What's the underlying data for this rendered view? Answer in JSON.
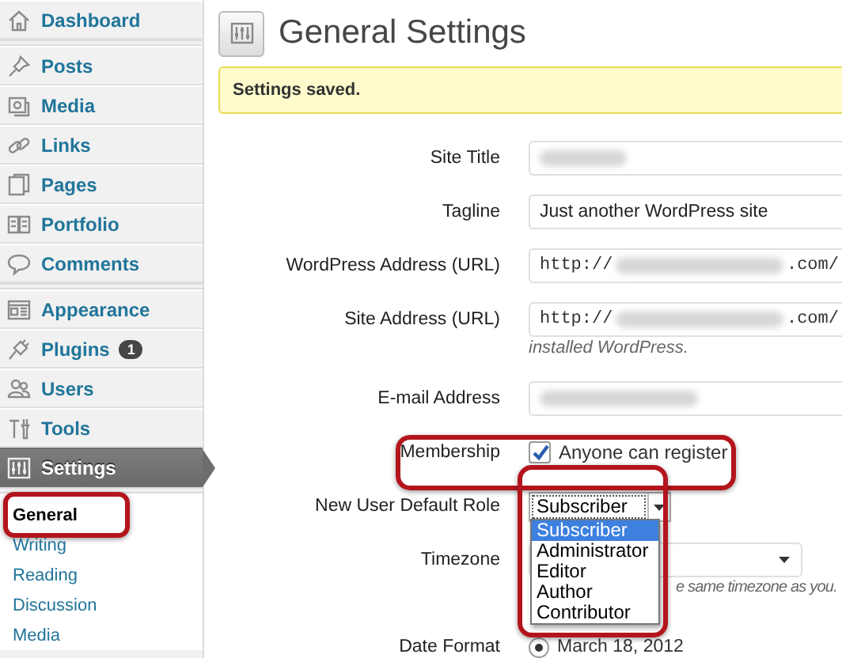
{
  "sidebar": {
    "groups": [
      {
        "items": [
          {
            "label": "Dashboard",
            "kind": "home",
            "selected": false
          }
        ]
      },
      {
        "items": [
          {
            "label": "Posts",
            "kind": "pin",
            "selected": false
          },
          {
            "label": "Media",
            "kind": "media",
            "selected": false
          },
          {
            "label": "Links",
            "kind": "link",
            "selected": false
          },
          {
            "label": "Pages",
            "kind": "pages",
            "selected": false
          },
          {
            "label": "Portfolio",
            "kind": "portfolio",
            "selected": false
          },
          {
            "label": "Comments",
            "kind": "comments",
            "selected": false
          }
        ]
      },
      {
        "items": [
          {
            "label": "Appearance",
            "kind": "appearance",
            "selected": false
          },
          {
            "label": "Plugins",
            "kind": "plugins",
            "selected": false,
            "badge": "1"
          },
          {
            "label": "Users",
            "kind": "users",
            "selected": false
          },
          {
            "label": "Tools",
            "kind": "tools",
            "selected": false
          },
          {
            "label": "Settings",
            "kind": "settings",
            "selected": true
          }
        ]
      }
    ],
    "submenu": [
      {
        "label": "General",
        "selected": true,
        "highlighted": true
      },
      {
        "label": "Writing",
        "selected": false,
        "highlighted": false
      },
      {
        "label": "Reading",
        "selected": false,
        "highlighted": false
      },
      {
        "label": "Discussion",
        "selected": false,
        "highlighted": false
      },
      {
        "label": "Media",
        "selected": false,
        "highlighted": false
      }
    ]
  },
  "page": {
    "title": "General Settings",
    "notice": "Settings saved."
  },
  "fields": [
    {
      "label": "Site Title",
      "kind": "redacted",
      "highlighted": false
    },
    {
      "label": "Tagline",
      "kind": "text",
      "value": "Just another WordPress site",
      "highlighted": false
    },
    {
      "label": "WordPress Address (URL)",
      "kind": "url",
      "prefix": "http://",
      "suffix": ".com/",
      "highlighted": false
    },
    {
      "label": "Site Address (URL)",
      "kind": "url",
      "prefix": "http://",
      "suffix": ".com/",
      "description": "installed WordPress.",
      "highlighted": false
    },
    {
      "label": "E-mail Address",
      "kind": "redacted",
      "highlighted": false
    },
    {
      "label": "Membership",
      "kind": "checkbox",
      "checked": true,
      "option": "Anyone can register",
      "highlighted": true
    },
    {
      "label": "New User Default Role",
      "kind": "select",
      "value": "Subscriber",
      "expanded": true,
      "highlighted": true,
      "options": [
        {
          "label": "Subscriber",
          "selected": true
        },
        {
          "label": "Administrator",
          "selected": false
        },
        {
          "label": "Editor",
          "selected": false
        },
        {
          "label": "Author",
          "selected": false
        },
        {
          "label": "Contributor",
          "selected": false
        }
      ]
    },
    {
      "label": "Timezone",
      "kind": "select",
      "description": "e same timezone as you.",
      "highlighted": false
    },
    {
      "label": "Date Format",
      "kind": "radio",
      "selected": true,
      "option": "March 18, 2012",
      "highlighted": false
    }
  ]
}
